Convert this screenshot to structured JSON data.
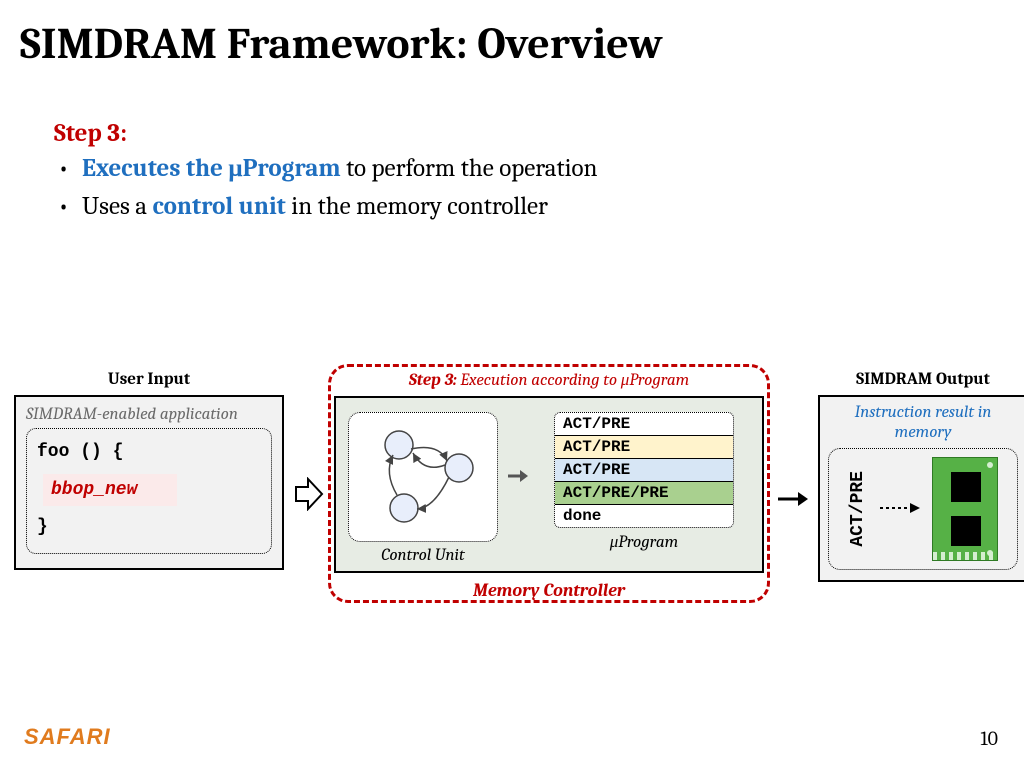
{
  "title": "SIMDRAM Framework: Overview",
  "step_label": "Step 3:",
  "bullets": {
    "b1_lead": "Executes the μProgram",
    "b1_rest": " to perform the operation",
    "b2_pre": "Uses a ",
    "b2_hl": "control unit",
    "b2_post": " in the memory controller"
  },
  "user_input": {
    "header": "User Input",
    "app_title": "SIMDRAM-enabled application",
    "code_open": "foo () {",
    "code_highlight": "bbop_new",
    "code_close": "}"
  },
  "mc": {
    "caption_bold": "Step 3:",
    "caption_rest": " Execution according to μProgram",
    "control_unit": "Control Unit",
    "uprogram": "μProgram",
    "label": "Memory Controller",
    "rows": [
      "ACT/PRE",
      "ACT/PRE",
      "ACT/PRE",
      "ACT/PRE/PRE",
      "done"
    ]
  },
  "output": {
    "header": "SIMDRAM Output",
    "title": "Instruction result in memory",
    "actpre": "ACT/PRE"
  },
  "footer": "SAFARI",
  "page": "10"
}
